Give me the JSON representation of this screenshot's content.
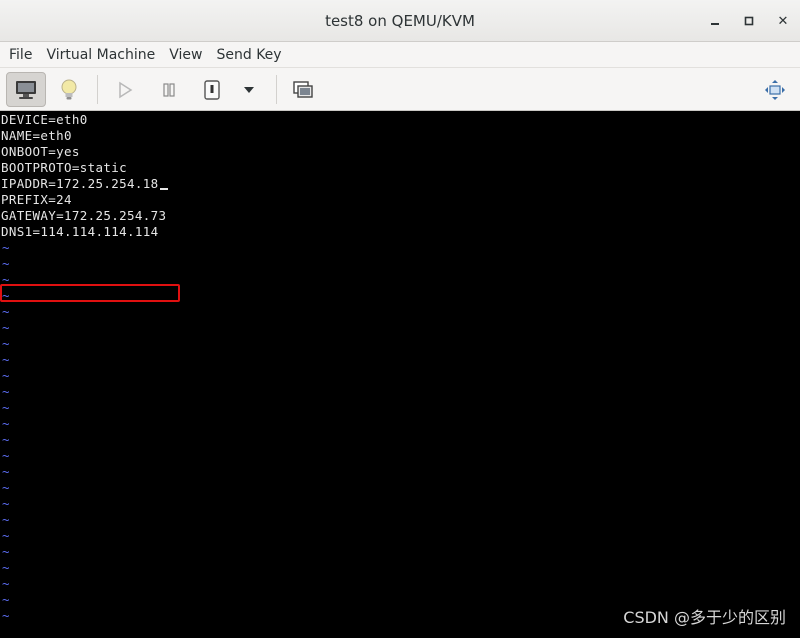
{
  "window": {
    "title": "test8 on QEMU/KVM",
    "controls": {
      "minimize_icon": "minimize-icon",
      "maximize_icon": "maximize-icon",
      "close_label": "✕"
    }
  },
  "menubar": {
    "items": [
      {
        "label": "File"
      },
      {
        "label": "Virtual Machine"
      },
      {
        "label": "View"
      },
      {
        "label": "Send Key"
      }
    ]
  },
  "toolbar": {
    "buttons": [
      {
        "name": "console-view-button",
        "icon": "monitor-icon",
        "active": true
      },
      {
        "name": "details-view-button",
        "icon": "lightbulb-icon",
        "active": false
      },
      {
        "name": "run-button",
        "icon": "play-icon",
        "active": false,
        "disabled": true
      },
      {
        "name": "pause-button",
        "icon": "pause-icon",
        "active": false
      },
      {
        "name": "shutdown-button",
        "icon": "power-icon",
        "active": false
      },
      {
        "name": "shutdown-menu-button",
        "icon": "chevron-down-icon",
        "active": false
      },
      {
        "name": "snapshots-button",
        "icon": "snapshots-icon",
        "active": false
      },
      {
        "name": "fullscreen-button",
        "icon": "fullscreen-icon",
        "active": false
      }
    ]
  },
  "console": {
    "lines": [
      "DEVICE=eth0",
      "NAME=eth0",
      "ONBOOT=yes",
      "BOOTPROTO=static",
      "IPADDR=172.25.254.18",
      "PREFIX=24",
      "GATEWAY=172.25.254.73",
      "DNS1=114.114.114.114"
    ],
    "tilde": "~",
    "tilde_count": 24,
    "highlighted_line_index": 4,
    "highlight_color": "#e01010",
    "tilde_color": "#5b6cf0"
  },
  "watermark": {
    "text": "CSDN @多于少的区别"
  }
}
